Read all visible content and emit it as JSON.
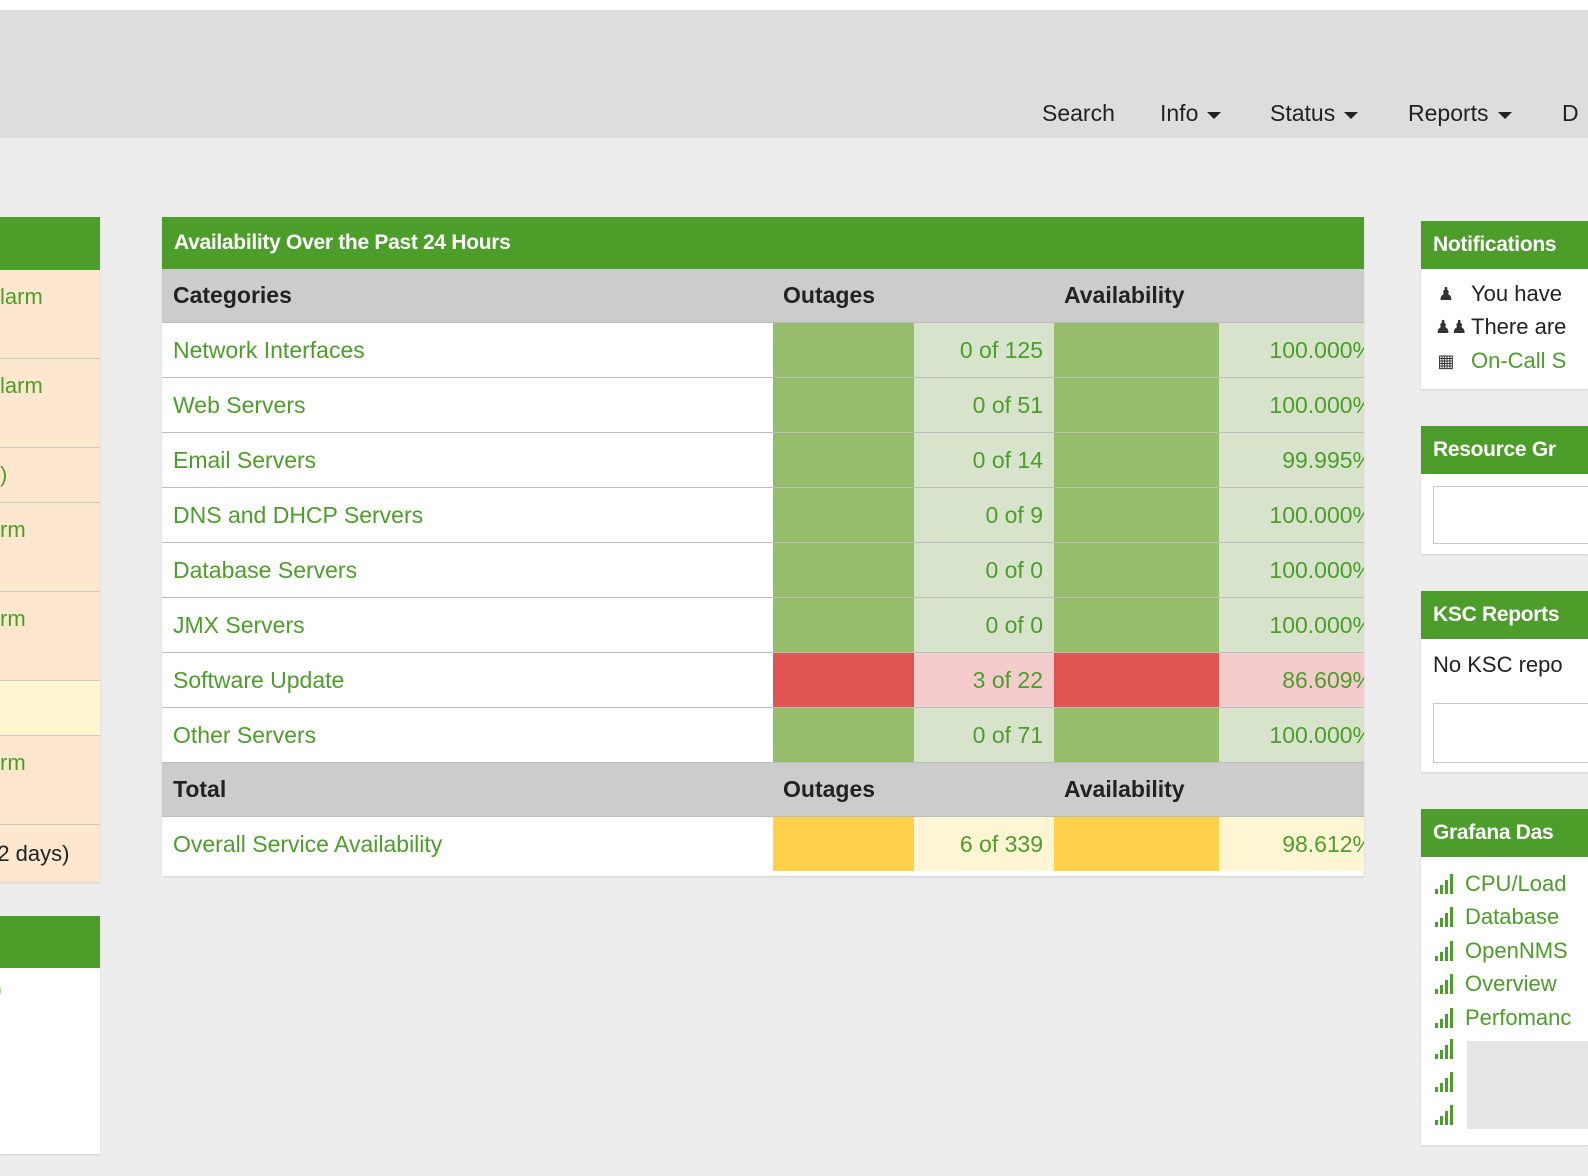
{
  "nav": {
    "items": [
      {
        "label": "Search",
        "dropdown": false
      },
      {
        "label": "Info",
        "dropdown": true
      },
      {
        "label": "Status",
        "dropdown": true
      },
      {
        "label": "Reports",
        "dropdown": true
      },
      {
        "label": "D",
        "dropdown": false
      }
    ]
  },
  "left_panel": {
    "rows": [
      {
        "text": "larm"
      },
      {
        "text": "larm"
      },
      {
        "text": ")"
      },
      {
        "text": "rm"
      },
      {
        "text": "rm"
      },
      {
        "text": ""
      },
      {
        "text": "rm"
      },
      {
        "text": " (2 days)"
      }
    ],
    "second_body": ")"
  },
  "availability": {
    "title": "Availability Over the Past 24 Hours",
    "headers": {
      "categories": "Categories",
      "outages": "Outages",
      "availability": "Availability"
    },
    "rows": [
      {
        "category": "Network Interfaces",
        "outages": "0 of 125",
        "availability": "100.000%",
        "status": "green"
      },
      {
        "category": "Web Servers",
        "outages": "0 of 51",
        "availability": "100.000%",
        "status": "green"
      },
      {
        "category": "Email Servers",
        "outages": "0 of 14",
        "availability": "99.995%",
        "status": "green"
      },
      {
        "category": "DNS and DHCP Servers",
        "outages": "0 of 9",
        "availability": "100.000%",
        "status": "green"
      },
      {
        "category": "Database Servers",
        "outages": "0 of 0",
        "availability": "100.000%",
        "status": "green"
      },
      {
        "category": "JMX Servers",
        "outages": "0 of 0",
        "availability": "100.000%",
        "status": "green"
      },
      {
        "category": "Software Update",
        "outages": "3 of 22",
        "availability": "86.609%",
        "status": "red"
      },
      {
        "category": "Other Servers",
        "outages": "0 of 71",
        "availability": "100.000%",
        "status": "green"
      }
    ],
    "total_headers": {
      "label": "Total",
      "outages": "Outages",
      "availability": "Availability"
    },
    "total": {
      "category": "Overall Service Availability",
      "outages": "6 of 339",
      "availability": "98.612%",
      "status": "yellow"
    }
  },
  "notifications": {
    "title": "Notifications",
    "lines": [
      {
        "icon": "user-icon",
        "text": "You have",
        "link": false
      },
      {
        "icon": "users-icon",
        "text": "There are",
        "link": false
      },
      {
        "icon": "calendar-icon",
        "text": "On-Call S",
        "link": true
      }
    ]
  },
  "resource_graphs": {
    "title": "Resource Gr"
  },
  "ksc_reports": {
    "title": "KSC Reports",
    "body": "No KSC repo"
  },
  "grafana": {
    "title": "Grafana Das",
    "items": [
      "CPU/Load",
      "Database",
      "OpenNMS",
      "Overview",
      "Perfomanc"
    ]
  },
  "colors": {
    "brand_green": "#4c9d2a",
    "ok_bar": "#95bd6c",
    "ok_bg": "#d7e4cb",
    "bad_bar": "#e05454",
    "bad_bg": "#f5cccc",
    "warn_bar": "#fdd14a",
    "warn_bg": "#fef5d3"
  }
}
